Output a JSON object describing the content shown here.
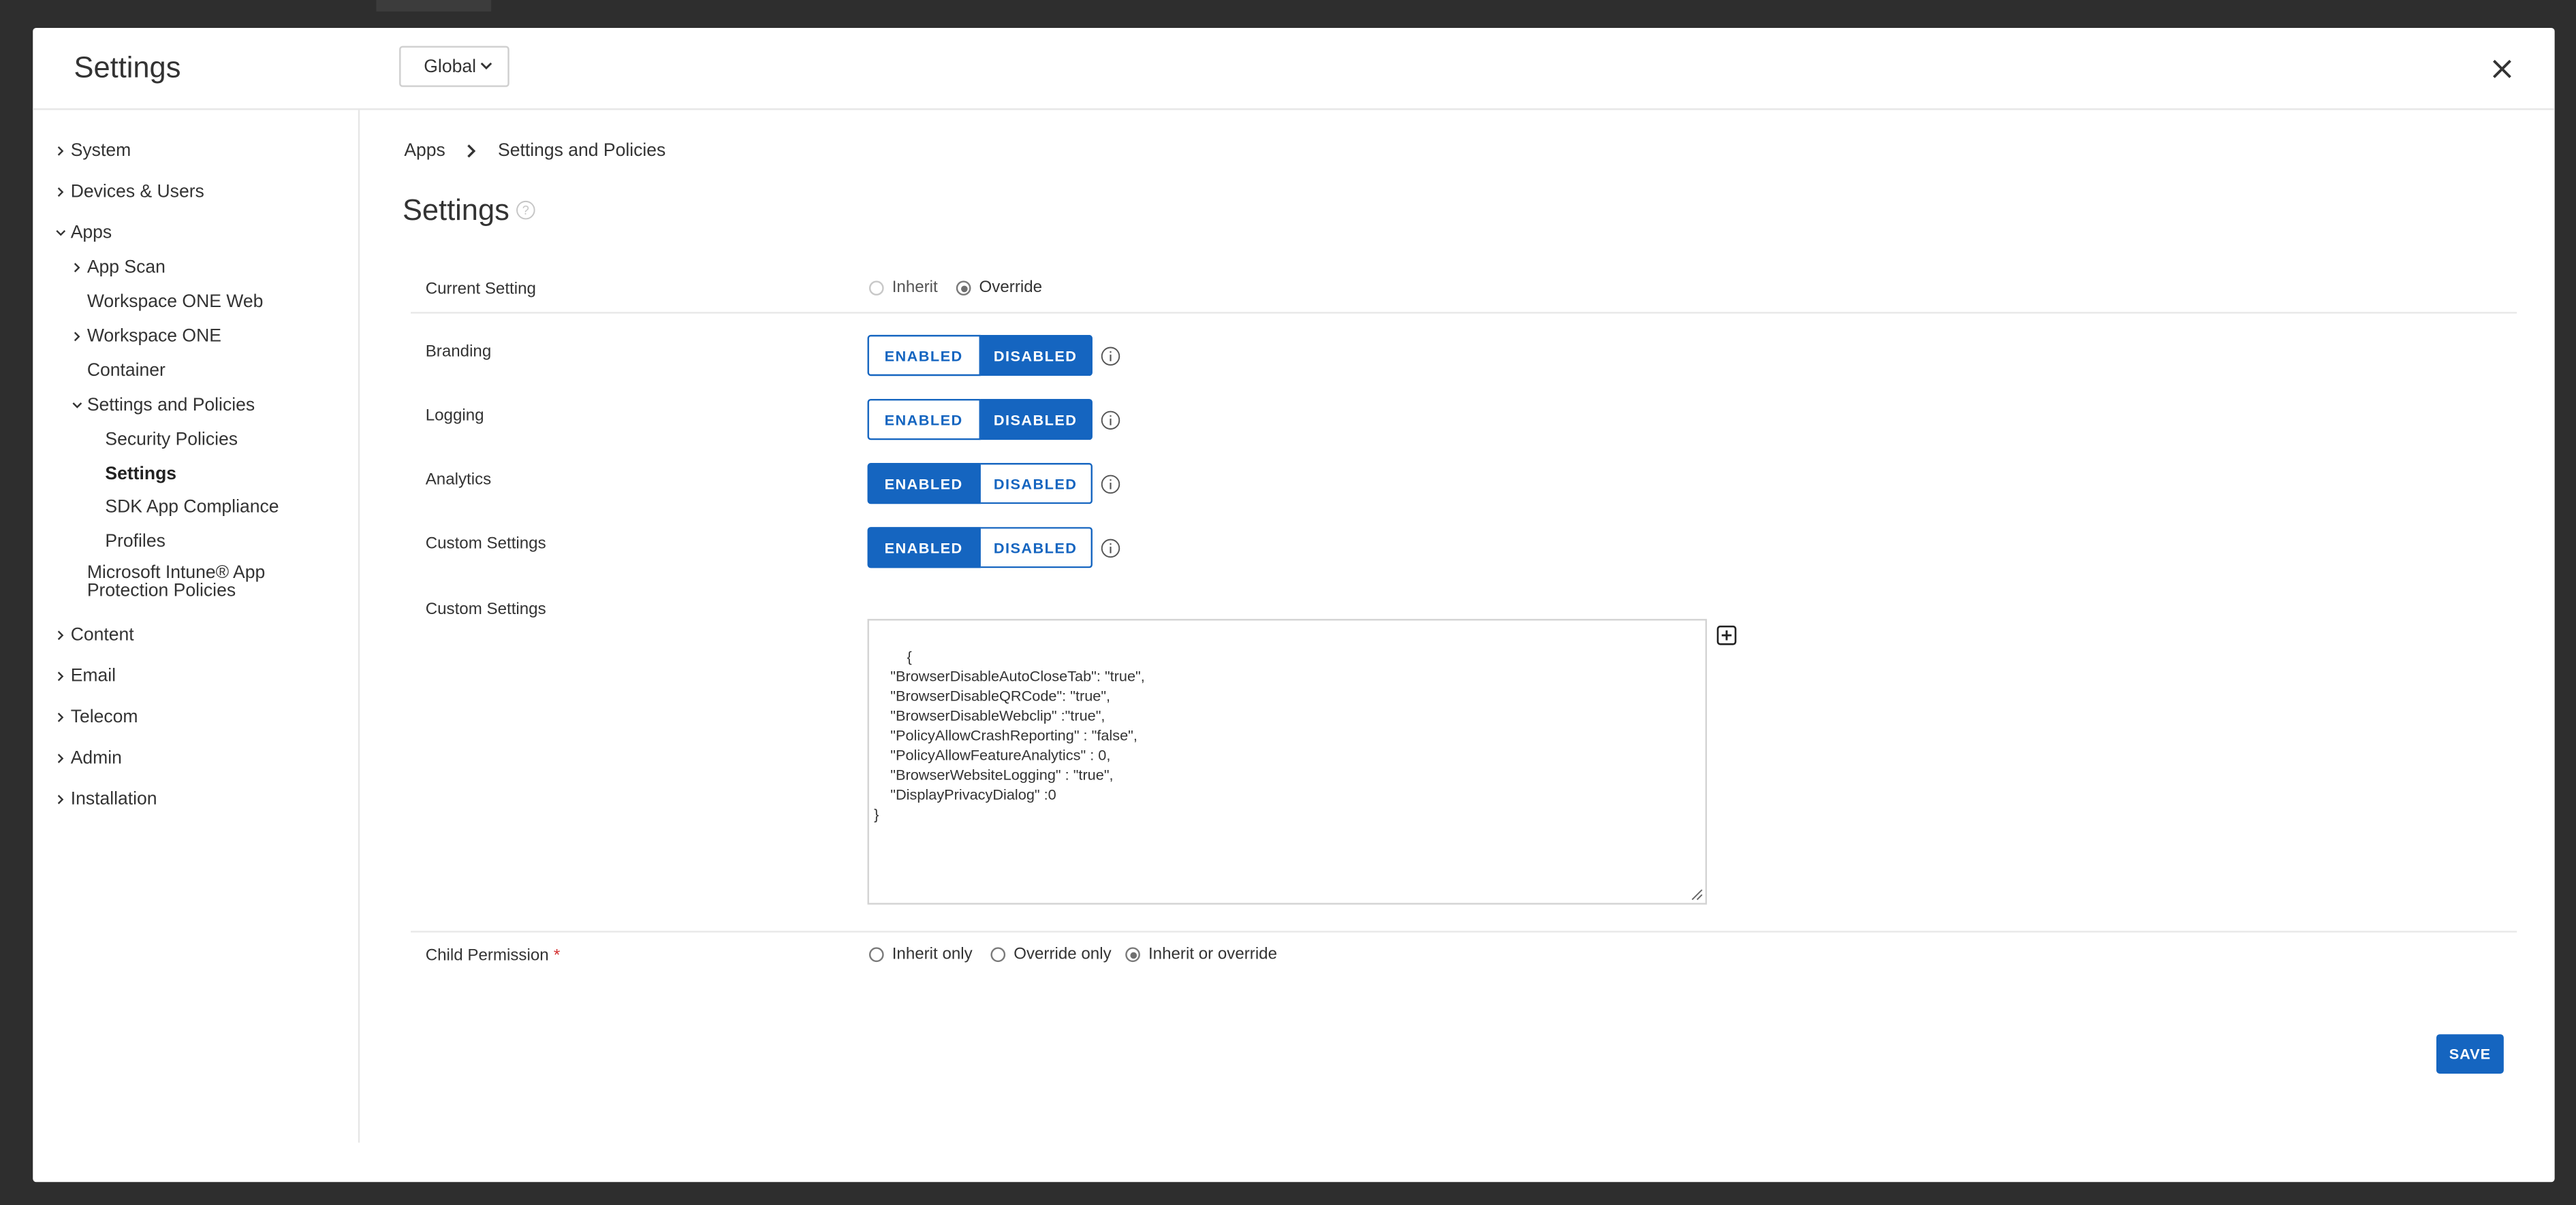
{
  "modal": {
    "title": "Settings",
    "scope_value": "Global",
    "close_icon": "close-icon"
  },
  "sidebar": {
    "items": [
      {
        "label": "System"
      },
      {
        "label": "Devices & Users"
      },
      {
        "label": "Apps"
      },
      {
        "label": "App Scan"
      },
      {
        "label": "Workspace ONE Web"
      },
      {
        "label": "Workspace ONE"
      },
      {
        "label": "Container"
      },
      {
        "label": "Settings and Policies"
      },
      {
        "label": "Security Policies"
      },
      {
        "label": "Settings"
      },
      {
        "label": "SDK App Compliance"
      },
      {
        "label": "Profiles"
      },
      {
        "label": "Microsoft Intune® App Protection Policies"
      },
      {
        "label": "Content"
      },
      {
        "label": "Email"
      },
      {
        "label": "Telecom"
      },
      {
        "label": "Admin"
      },
      {
        "label": "Installation"
      }
    ],
    "active": "Settings"
  },
  "breadcrumb": {
    "items": [
      "Apps",
      "Settings and Policies"
    ]
  },
  "page": {
    "title": "Settings"
  },
  "form": {
    "current_setting": {
      "label": "Current Setting",
      "options": [
        "Inherit",
        "Override"
      ],
      "selected": "Override"
    },
    "toggles": [
      {
        "label": "Branding",
        "on_label": "ENABLED",
        "off_label": "DISABLED",
        "value": "DISABLED"
      },
      {
        "label": "Logging",
        "on_label": "ENABLED",
        "off_label": "DISABLED",
        "value": "DISABLED"
      },
      {
        "label": "Analytics",
        "on_label": "ENABLED",
        "off_label": "DISABLED",
        "value": "ENABLED"
      },
      {
        "label": "Custom Settings",
        "on_label": "ENABLED",
        "off_label": "DISABLED",
        "value": "ENABLED"
      }
    ],
    "custom_settings": {
      "label": "Custom Settings",
      "value": "{\n    \"BrowserDisableAutoCloseTab\": \"true\",\n    \"BrowserDisableQRCode\": \"true\",\n    \"BrowserDisableWebclip\" :\"true\",\n    \"PolicyAllowCrashReporting\" : \"false\",\n    \"PolicyAllowFeatureAnalytics\" : 0,\n    \"BrowserWebsiteLogging\" : \"true\",\n    \"DisplayPrivacyDialog\" :0\n}"
    },
    "child_permission": {
      "label": "Child Permission",
      "required_mark": "*",
      "options": [
        "Inherit only",
        "Override only",
        "Inherit or override"
      ],
      "selected": "Inherit or override"
    },
    "save_label": "SAVE"
  },
  "colors": {
    "accent": "#1565c0",
    "required": "#d32f2f",
    "backdrop": "#2e2e2e"
  }
}
